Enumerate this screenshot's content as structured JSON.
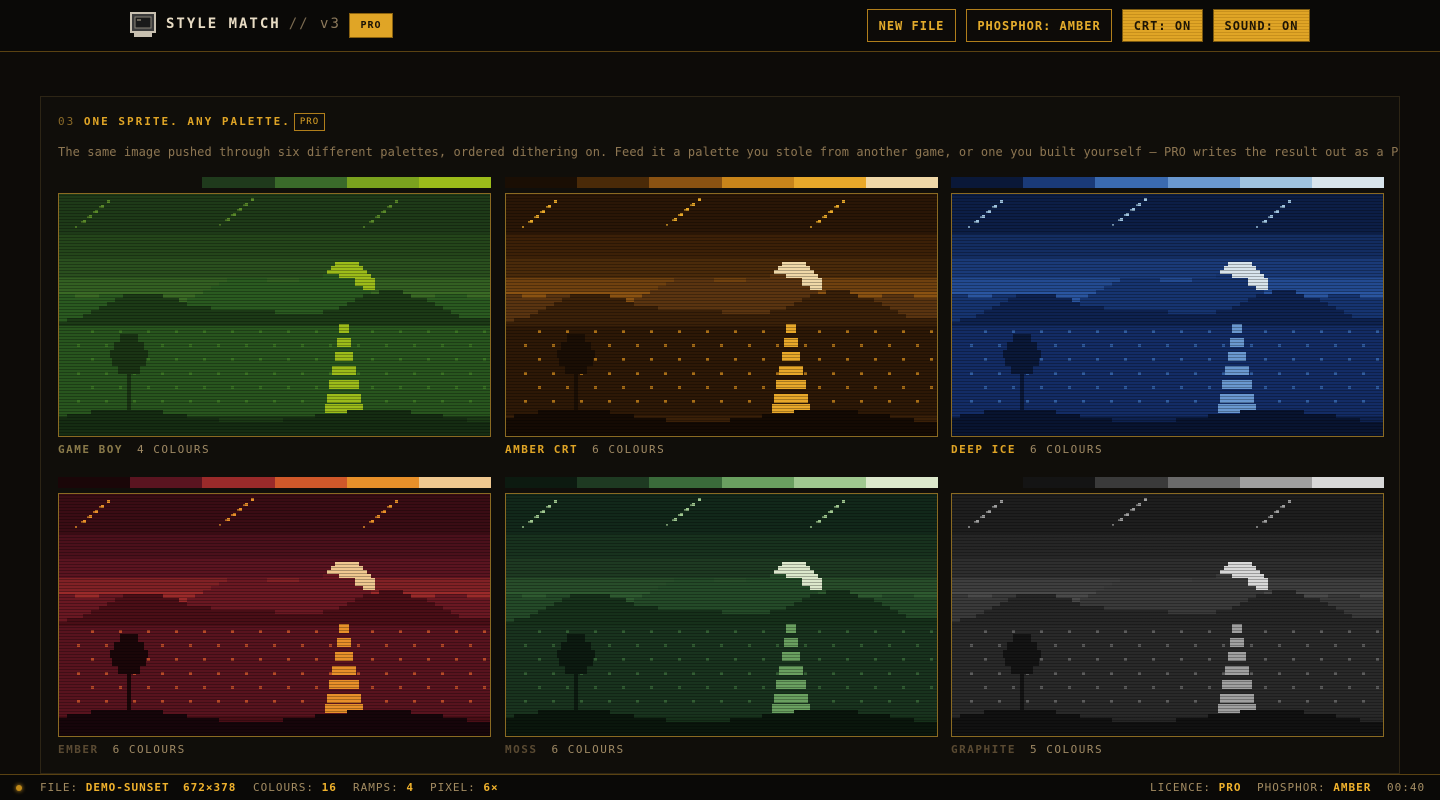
{
  "header": {
    "brand": "STYLE MATCH",
    "separator": "//",
    "version": "v3",
    "badge": "PRO",
    "buttons": {
      "new_file": "NEW FILE",
      "phosphor": "PHOSPHOR: AMBER",
      "crt": "CRT: ON",
      "sound": "SOUND: ON"
    }
  },
  "section": {
    "number": "03",
    "title": "ONE SPRITE. ANY PALETTE.",
    "badge": "PRO",
    "description": "The same image pushed through six different palettes, ordered dithering on. Feed it a palette you stole from another game, or one you built yourself — PRO writes the result out as a PNG."
  },
  "palettes": [
    {
      "name": "GAME BOY",
      "count": "4 COLOURS",
      "label_color": "#8a7a4a",
      "swatches": [
        "#1f3a1c",
        "#3a6a2a",
        "#7aa21e",
        "#9cbc1a"
      ],
      "scene": {
        "sky_top": "#1e3a18",
        "sky_mid": "#2a4f1e",
        "sky_low": "#3a6a25",
        "glow": "#6a9a1e",
        "sun": "#9cbc1a",
        "stars": "#5a8a2a",
        "hills_far": "#2a5a20",
        "hills_near": "#1c3a16",
        "ground": "#2a5a20",
        "ground_dots": "#3f7a26",
        "tower": "#9cbc1a",
        "tree": "#1a3414",
        "shore": "#152c12"
      }
    },
    {
      "name": "AMBER CRT",
      "count": "6 COLOURS",
      "label_color": "#e0a526",
      "swatches": [
        "#1a0e04",
        "#4a2a08",
        "#8a5212",
        "#c8841a",
        "#e8a82a",
        "#f0d8a8"
      ],
      "scene": {
        "sky_top": "#2a1606",
        "sky_mid": "#4a2a0a",
        "sky_low": "#8a5212",
        "glow": "#c8841a",
        "sun": "#f0d8a8",
        "stars": "#e8a82a",
        "hills_far": "#5a3410",
        "hills_near": "#3a2008",
        "ground": "#2c1806",
        "ground_dots": "#c8841a",
        "tower": "#e8a82a",
        "tree": "#1a0e04",
        "shore": "#140a03"
      }
    },
    {
      "name": "DEEP ICE",
      "count": "6 COLOURS",
      "label_color": "#e0a526",
      "swatches": [
        "#0a1838",
        "#1a3a78",
        "#3a6ab0",
        "#6a98d0",
        "#a0c4e0",
        "#d8e4ec"
      ],
      "scene": {
        "sky_top": "#0c1e46",
        "sky_mid": "#1a3a78",
        "sky_low": "#2a55a0",
        "glow": "#6a98d0",
        "sun": "#d8e4ec",
        "stars": "#a0c4e0",
        "hills_far": "#163470",
        "hills_near": "#0e2250",
        "ground": "#142e68",
        "ground_dots": "#3a6ab0",
        "tower": "#6a98d0",
        "tree": "#0a1838",
        "shore": "#081430"
      }
    },
    {
      "name": "EMBER",
      "count": "6 COLOURS",
      "label_color": "#5a4a32",
      "swatches": [
        "#1a0608",
        "#5a1420",
        "#9a2a2a",
        "#d0582a",
        "#e8902a",
        "#f0c890"
      ],
      "scene": {
        "sky_top": "#3a0c14",
        "sky_mid": "#5a1420",
        "sky_low": "#9a2a2a",
        "glow": "#d0582a",
        "sun": "#f0c890",
        "stars": "#e8902a",
        "hills_far": "#6a1822",
        "hills_near": "#4a0e16",
        "ground": "#5a1420",
        "ground_dots": "#d0582a",
        "tower": "#e8902a",
        "tree": "#1a0608",
        "shore": "#16050a"
      }
    },
    {
      "name": "MOSS",
      "count": "6 COLOURS",
      "label_color": "#5a4a32",
      "swatches": [
        "#0c1a10",
        "#1e3a22",
        "#3a6a3a",
        "#6aa060",
        "#a0c890",
        "#dce8cc"
      ],
      "scene": {
        "sky_top": "#12281a",
        "sky_mid": "#1e3a22",
        "sky_low": "#2e5a30",
        "glow": "#6aa060",
        "sun": "#dce8cc",
        "stars": "#a0c890",
        "hills_far": "#244a28",
        "hills_near": "#16301a",
        "ground": "#1a3420",
        "ground_dots": "#3a6a3a",
        "tower": "#6aa060",
        "tree": "#0c1a10",
        "shore": "#0a160c"
      }
    },
    {
      "name": "GRAPHITE",
      "count": "5 COLOURS",
      "label_color": "#5a4a32",
      "swatches": [
        "#141414",
        "#3a3a3a",
        "#6a6a6a",
        "#a0a0a0",
        "#d8d8d8"
      ],
      "scene": {
        "sky_top": "#1e1e1e",
        "sky_mid": "#2e2e2e",
        "sky_low": "#4a4a4a",
        "glow": "#808080",
        "sun": "#d8d8d8",
        "stars": "#a0a0a0",
        "hills_far": "#3a3a3a",
        "hills_near": "#262626",
        "ground": "#2a2a2a",
        "ground_dots": "#6a6a6a",
        "tower": "#a0a0a0",
        "tree": "#141414",
        "shore": "#111111"
      }
    }
  ],
  "status": {
    "file_label": "FILE:",
    "file": "DEMO-SUNSET",
    "size": "672×378",
    "colours_label": "COLOURS:",
    "colours": "16",
    "ramps_label": "RAMPS:",
    "ramps": "4",
    "pixel_label": "PIXEL:",
    "pixel": "6×",
    "licence_label": "LICENCE:",
    "licence": "PRO",
    "phosphor_label": "PHOSPHOR:",
    "phosphor": "AMBER",
    "time": "00:40"
  }
}
